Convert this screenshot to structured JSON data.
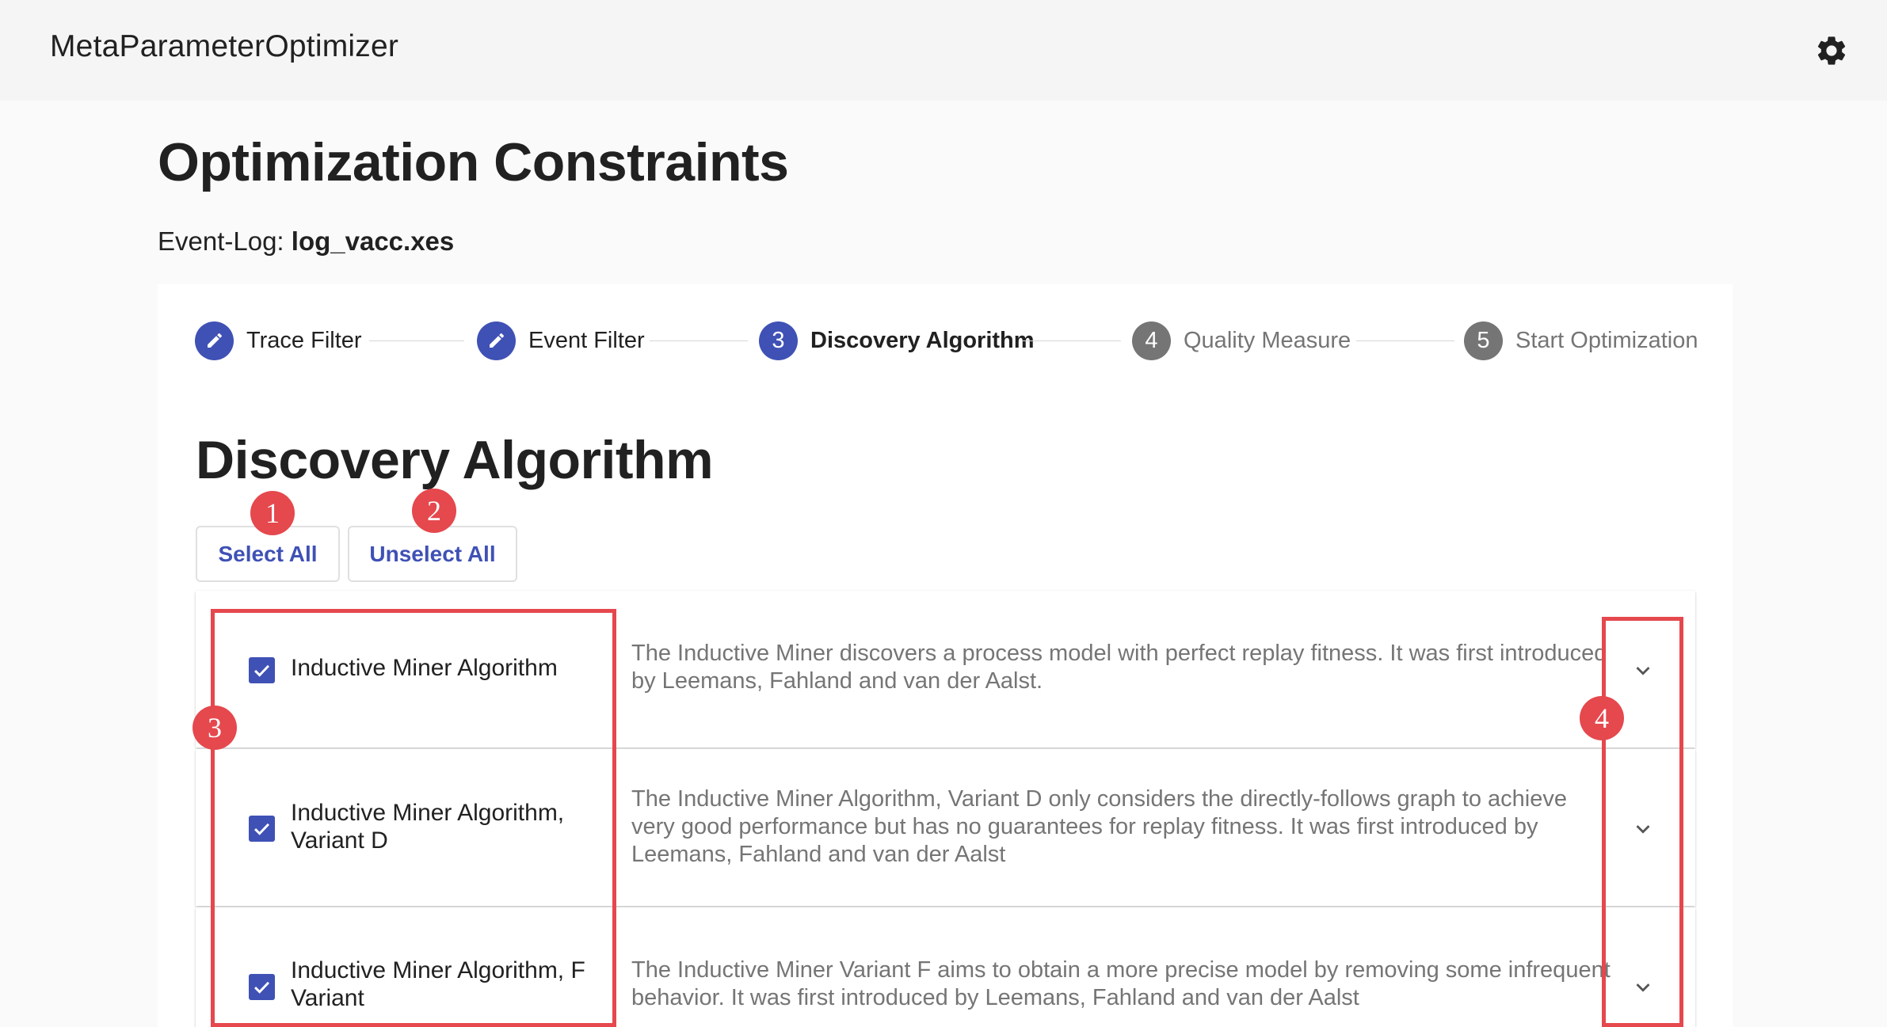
{
  "app": {
    "title": "MetaParameterOptimizer",
    "settings_icon": "gear-icon"
  },
  "page": {
    "title": "Optimization Constraints",
    "event_log_label": "Event-Log:",
    "event_log_file": "log_vacc.xes"
  },
  "stepper": {
    "steps": [
      {
        "marker": "",
        "icon": "pencil-icon",
        "label": "Trace Filter",
        "state": "done"
      },
      {
        "marker": "",
        "icon": "pencil-icon",
        "label": "Event Filter",
        "state": "done"
      },
      {
        "marker": "3",
        "label": "Discovery Algorithm",
        "state": "active"
      },
      {
        "marker": "4",
        "label": "Quality Measure",
        "state": "pending"
      },
      {
        "marker": "5",
        "label": "Start Optimization",
        "state": "pending"
      }
    ]
  },
  "section": {
    "title": "Discovery Algorithm",
    "select_all_label": "Select All",
    "unselect_all_label": "Unselect All"
  },
  "algorithms": [
    {
      "name": "Inductive Miner Algorithm",
      "checked": true,
      "description": "The Inductive Miner discovers a process model with perfect replay fitness. It was first introduced by Leemans, Fahland and van der Aalst."
    },
    {
      "name": "Inductive Miner Algorithm, Variant D",
      "checked": true,
      "description": "The Inductive Miner Algorithm, Variant D only considers the directly-follows graph to achieve very good performance but has no guarantees for replay fitness. It was first introduced by Leemans, Fahland and van der Aalst"
    },
    {
      "name": "Inductive Miner Algorithm, F Variant",
      "checked": true,
      "description": "The Inductive Miner Variant F aims to obtain a more precise model by removing some infrequent behavior. It was first introduced by Leemans, Fahland and van der Aalst"
    }
  ],
  "annotations": {
    "markers": [
      "1",
      "2",
      "3",
      "4"
    ]
  },
  "colors": {
    "primary": "#3f51b5",
    "pending": "#757575",
    "annotation": "#e5484d",
    "appbar_bg": "#f5f5f5"
  }
}
